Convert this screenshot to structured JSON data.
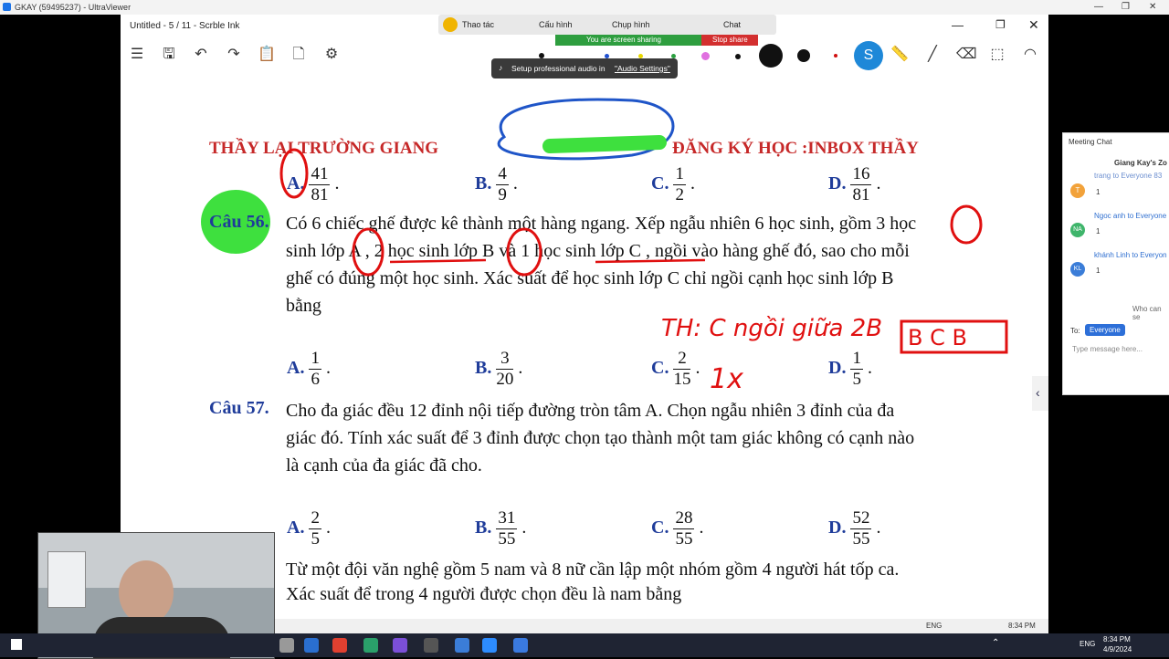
{
  "uv": {
    "title": "GKAY (59495237) - UltraViewer"
  },
  "app": {
    "doc_title": "Untitled - 5 / 11 - Scrble Ink"
  },
  "zoom": {
    "ops": "Thao tác",
    "config": "Cấu hình",
    "screenshot": "Chụp hình",
    "chat": "Chat",
    "sharing": "You are screen sharing",
    "stop": "Stop share",
    "audio_prefix": "Setup professional audio in",
    "audio_link": "\"Audio Settings\""
  },
  "header": {
    "left": "THẦY LẠI TRƯỜNG GIANG",
    "right": "ĐĂNG KÝ HỌC :INBOX THẦY"
  },
  "q55_answers": [
    {
      "label": "A.",
      "num": "41",
      "den": "81"
    },
    {
      "label": "B.",
      "num": "4",
      "den": "9"
    },
    {
      "label": "C.",
      "num": "1",
      "den": "2"
    },
    {
      "label": "D.",
      "num": "16",
      "den": "81"
    }
  ],
  "q56": {
    "label": "Câu 56.",
    "line1": "Có 6 chiếc ghế được kê thành một hàng ngang. Xếp ngẫu nhiên 6 học sinh, gồm 3 học",
    "line2": "sinh lớp  A , 2 học sinh lớp  B  và 1 học sinh lớp  C , ngồi vào hàng ghế đó, sao cho mỗi",
    "line3": "ghế có đúng một học sinh. Xác suất để học sinh lớp  C  chỉ ngồi cạnh học sinh lớp  B",
    "line4": "bằng",
    "answers": [
      {
        "label": "A.",
        "num": "1",
        "den": "6"
      },
      {
        "label": "B.",
        "num": "3",
        "den": "20"
      },
      {
        "label": "C.",
        "num": "2",
        "den": "15"
      },
      {
        "label": "D.",
        "num": "1",
        "den": "5"
      }
    ]
  },
  "q57": {
    "label": "Câu 57.",
    "line1": "Cho đa giác đều 12 đỉnh nội tiếp đường tròn tâm A. Chọn ngẫu nhiên 3 đỉnh của đa",
    "line2": "giác đó. Tính xác suất để 3 đỉnh được chọn tạo thành một tam giác không có cạnh nào",
    "line3": "là cạnh của đa giác đã cho.",
    "answers": [
      {
        "label": "A.",
        "num": "2",
        "den": "5"
      },
      {
        "label": "B.",
        "num": "31",
        "den": "55"
      },
      {
        "label": "C.",
        "num": "28",
        "den": "55"
      },
      {
        "label": "D.",
        "num": "52",
        "den": "55"
      }
    ]
  },
  "q58": {
    "line1": "Từ một đội văn nghệ gồm 5 nam và 8 nữ cần lập một nhóm gồm 4 người hát tốp ca.",
    "line2": "Xác suất để trong 4 người được chọn đều là nam bằng"
  },
  "ink": {
    "note": "TH: C ngồi giữa 2B",
    "box": "B C B",
    "count": "1x"
  },
  "chat": {
    "title": "Meeting Chat",
    "room": "Giang Kay's Zo",
    "partial": "trang to Everyone 83",
    "messages": [
      {
        "initial": "T",
        "color": "#f2a23a",
        "from": "",
        "text": "1"
      },
      {
        "initial": "NA",
        "color": "#3fb56b",
        "from": "Ngoc anh to Everyone",
        "text": "1"
      },
      {
        "initial": "KL",
        "color": "#3b7dd8",
        "from": "khánh Linh to Everyon",
        "text": "1"
      }
    ],
    "who": "Who can se",
    "to_label": "To:",
    "to_value": "Everyone",
    "placeholder": "Type message here..."
  },
  "status": {
    "lang": "ENG",
    "time": "8:34 PM"
  },
  "taskbar": {
    "lang": "ENG",
    "time": "8:34 PM",
    "date": "4/9/2024"
  }
}
